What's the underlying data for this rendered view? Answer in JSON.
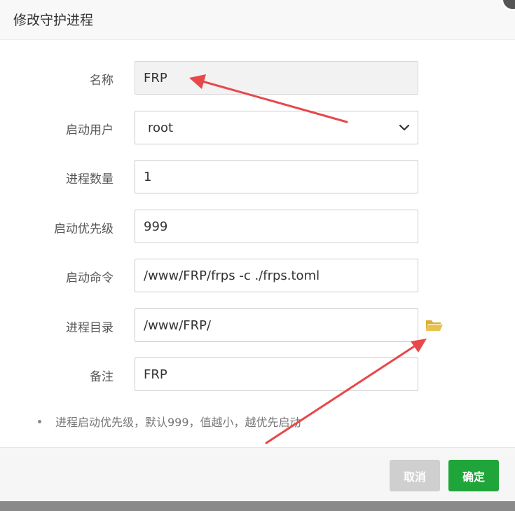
{
  "dialog": {
    "title": "修改守护进程"
  },
  "form": {
    "name": {
      "label": "名称",
      "value": "FRP"
    },
    "user": {
      "label": "启动用户",
      "value": "root"
    },
    "count": {
      "label": "进程数量",
      "value": "1"
    },
    "priority": {
      "label": "启动优先级",
      "value": "999"
    },
    "command": {
      "label": "启动命令",
      "value": "/www/FRP/frps -c ./frps.toml"
    },
    "directory": {
      "label": "进程目录",
      "value": "/www/FRP/"
    },
    "note": {
      "label": "备注",
      "value": "FRP"
    }
  },
  "tip": "进程启动优先级，默认999，值越小，越优先启动",
  "footer": {
    "cancel_label": "取消",
    "confirm_label": "确定"
  },
  "colors": {
    "confirm": "#20a53a",
    "cancel": "#cfcfcf",
    "folder": "#e8c24d",
    "annotation_arrow": "#e8484a"
  },
  "icons": {
    "folder": "folder-open-icon",
    "dropdown": "chevron-down-icon",
    "close": "close-icon"
  }
}
